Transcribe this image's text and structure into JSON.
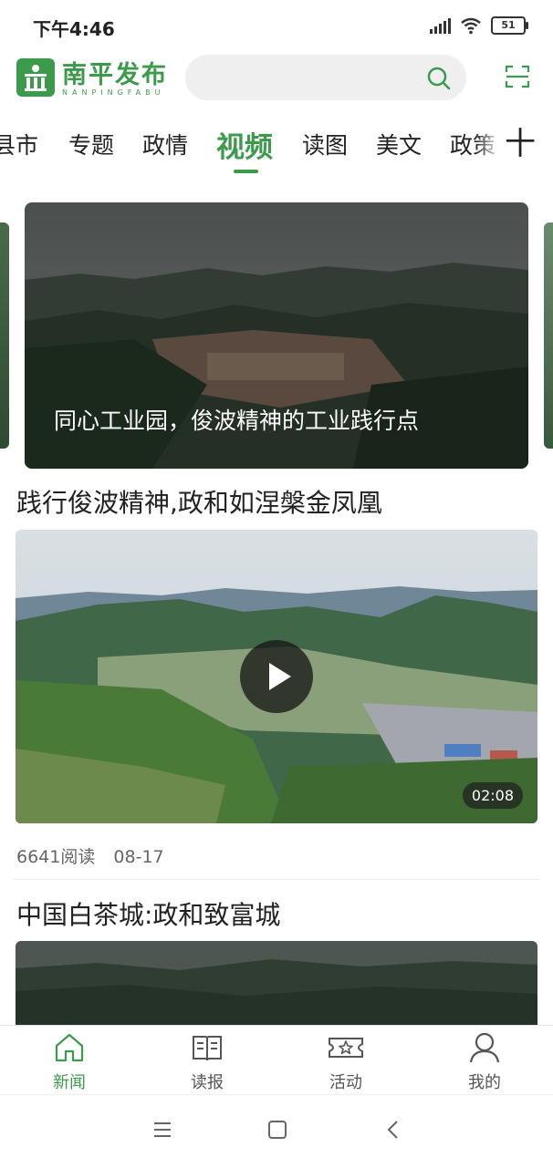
{
  "status_bar": {
    "time": "下午4:46",
    "battery": "51"
  },
  "header": {
    "logo_cn": "南平发布",
    "logo_en": "NANPINGFABU",
    "search_placeholder": ""
  },
  "tabs": [
    {
      "label": "县市"
    },
    {
      "label": "专题"
    },
    {
      "label": "政情"
    },
    {
      "label": "视频"
    },
    {
      "label": "读图"
    },
    {
      "label": "美文"
    },
    {
      "label": "政策"
    }
  ],
  "active_tab": "视频",
  "add_channel_label": "十",
  "banner": {
    "caption": "同心工业园，俊波精神的工业践行点"
  },
  "articles": [
    {
      "title": "践行俊波精神,政和如涅槃金凤凰",
      "duration": "02:08",
      "reads": "6641阅读",
      "date": "08-17"
    },
    {
      "title": "中国白茶城:政和致富城"
    }
  ],
  "bottom_nav": [
    {
      "label": "新闻",
      "icon": "home-icon"
    },
    {
      "label": "读报",
      "icon": "book-icon"
    },
    {
      "label": "活动",
      "icon": "ticket-star-icon"
    },
    {
      "label": "我的",
      "icon": "user-icon"
    }
  ],
  "colors": {
    "accent": "#3c9a4b"
  }
}
